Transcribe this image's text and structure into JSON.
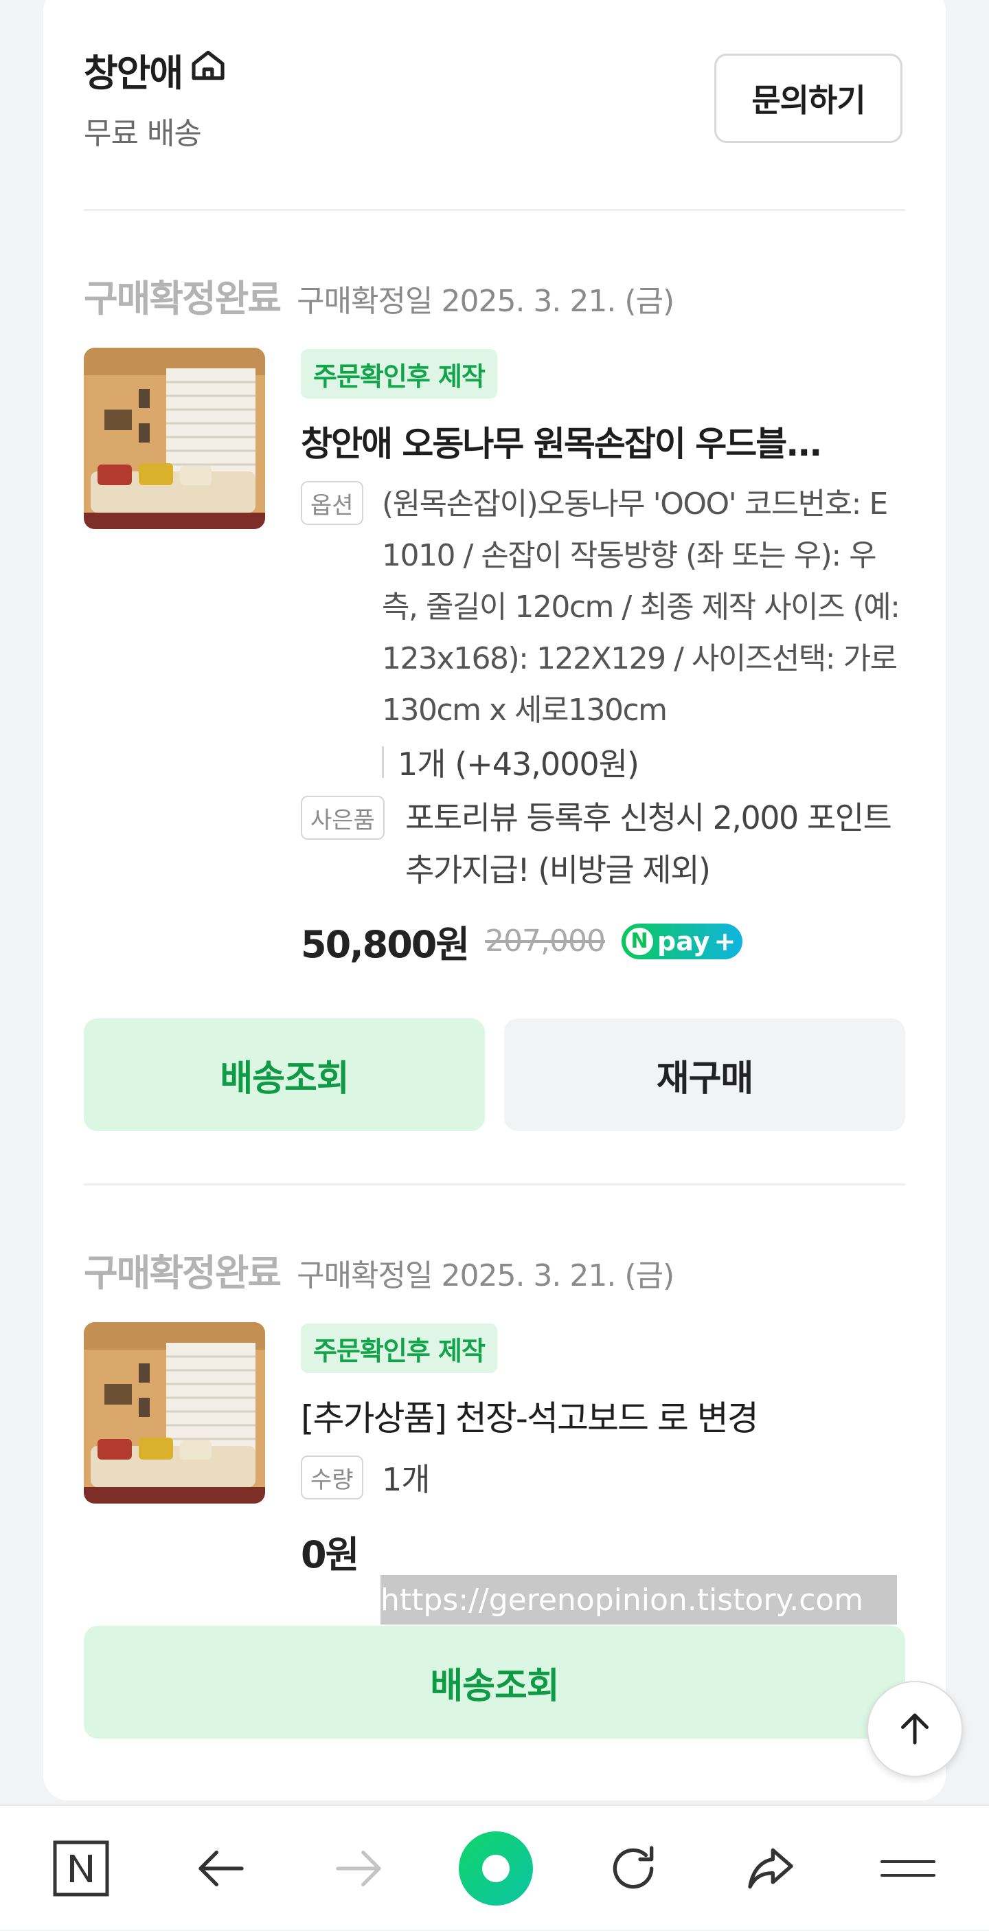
{
  "store": {
    "name": "창안애",
    "shipping": "무료 배송",
    "inquiry_label": "문의하기"
  },
  "orders": [
    {
      "status": "구매확정완료",
      "date": "구매확정일 2025. 3. 21. (금)",
      "tag": "주문확인후 제작",
      "title": "창안애 오동나무 원목손잡이 우드블...",
      "option_label": "옵션",
      "option_text": "(원목손잡이)오동나무 'OOO' 코드번호: E1010 / 손잡이 작동방향 (좌 또는 우): 우측, 줄길이 120cm / 최종 제작 사이즈 (예:123x168): 122X129 / 사이즈선택: 가로130cm x 세로130cm",
      "quantity_text": "1개 (+43,000원)",
      "gift_label": "사은품",
      "gift_text": "포토리뷰 등록후 신청시 2,000 포인트 추가지급! (비방글 제외)",
      "price": "50,800원",
      "original_price": "207,000",
      "npay_label": "pay",
      "track_label": "배송조회",
      "rebuy_label": "재구매"
    },
    {
      "status": "구매확정완료",
      "date": "구매확정일 2025. 3. 21. (금)",
      "tag": "주문확인후 제작",
      "title": "[추가상품] 천장-석고보드 로 변경",
      "qty_label": "수량",
      "qty_value": "1개",
      "price": "0원",
      "track_label": "배송조회"
    }
  ],
  "watermark": "https://gerenopinion.tistory.com",
  "bottom_nav": [
    "naver-n-icon",
    "back-arrow-icon",
    "forward-arrow-icon",
    "home-circle-icon",
    "refresh-icon",
    "share-icon",
    "menu-icon"
  ],
  "colors": {
    "accent_green": "#0f9a45",
    "tag_bg": "#dff5e6",
    "button_green_bg": "#dbf6e3"
  }
}
